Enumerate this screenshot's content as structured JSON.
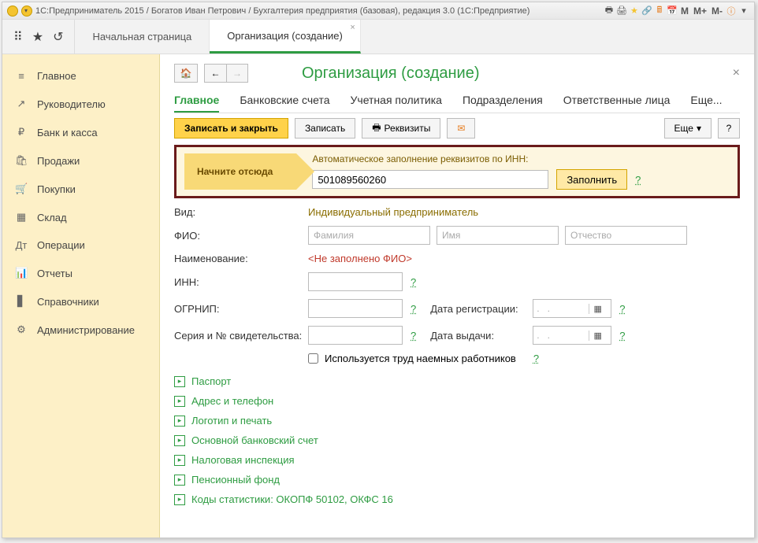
{
  "titlebar": {
    "title": "1С:Предприниматель 2015 / Богатов Иван Петрович / Бухгалтерия предприятия (базовая), редакция 3.0   (1С:Предприятие)",
    "m1": "M",
    "m2": "M+",
    "m3": "M-"
  },
  "tabs": {
    "start": "Начальная страница",
    "org": "Организация (создание)"
  },
  "sidebar": [
    {
      "icon": "≡",
      "label": "Главное"
    },
    {
      "icon": "↗",
      "label": "Руководителю"
    },
    {
      "icon": "₽",
      "label": "Банк и касса"
    },
    {
      "icon": "🛍",
      "label": "Продажи"
    },
    {
      "icon": "🛒",
      "label": "Покупки"
    },
    {
      "icon": "▦",
      "label": "Склад"
    },
    {
      "icon": "Дт",
      "label": "Операции"
    },
    {
      "icon": "📊",
      "label": "Отчеты"
    },
    {
      "icon": "▋",
      "label": "Справочники"
    },
    {
      "icon": "⚙",
      "label": "Администрирование"
    }
  ],
  "page": {
    "title": "Организация (создание)"
  },
  "subtabs": [
    "Главное",
    "Банковские счета",
    "Учетная политика",
    "Подразделения",
    "Ответственные лица",
    "Еще..."
  ],
  "actions": {
    "saveClose": "Записать и закрыть",
    "save": "Записать",
    "requisites": "Реквизиты",
    "more": "Еще",
    "help": "?"
  },
  "hint": {
    "start": "Начните отсюда",
    "autoLabel": "Автоматическое заполнение реквизитов по ИНН:",
    "inn": "501089560260",
    "fill": "Заполнить",
    "q": "?"
  },
  "form": {
    "vidLabel": "Вид:",
    "vidValue": "Индивидуальный предприниматель",
    "fioLabel": "ФИО:",
    "famPh": "Фамилия",
    "imPh": "Имя",
    "otPh": "Отчество",
    "nameLabel": "Наименование:",
    "nameValue": "<Не заполнено ФИО>",
    "innLabel": "ИНН:",
    "ogrnipLabel": "ОГРНИП:",
    "regDateLabel": "Дата регистрации:",
    "seriesLabel": "Серия и № свидетельства:",
    "issueDateLabel": "Дата выдачи:",
    "datePh": ".   .",
    "checkboxLabel": "Используется труд наемных работников",
    "q": "?"
  },
  "expanders": [
    "Паспорт",
    "Адрес и телефон",
    "Логотип и печать",
    "Основной банковский счет",
    "Налоговая инспекция",
    "Пенсионный фонд",
    "Коды статистики: ОКОПФ 50102, ОКФС 16"
  ]
}
